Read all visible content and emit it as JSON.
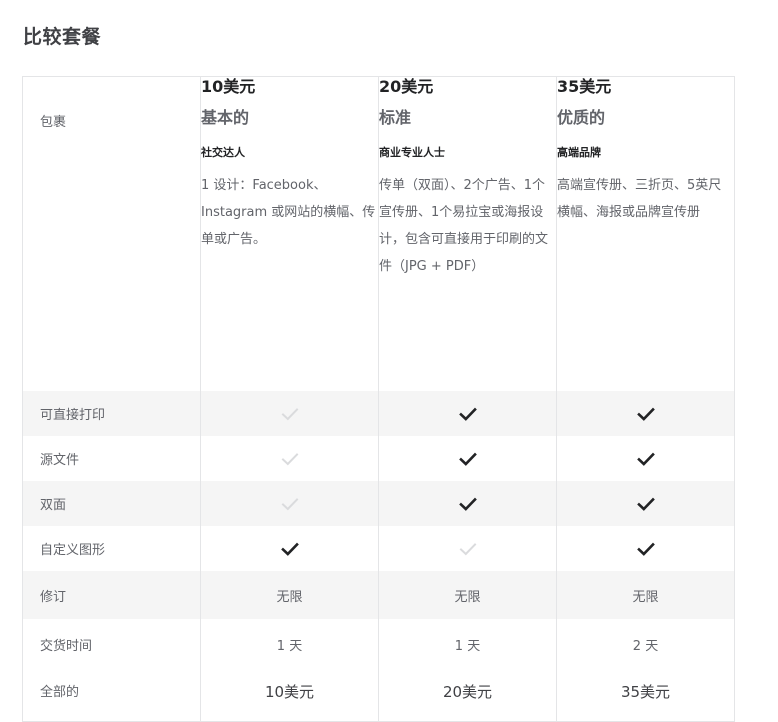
{
  "page": {
    "title": "比较套餐"
  },
  "table": {
    "header_label": "包裹",
    "packages": [
      {
        "price": "10美元",
        "name": "基本的",
        "tagline": "社交达人",
        "description": "1 设计：Facebook、Instagram 或网站的横幅、传单或广告。"
      },
      {
        "price": "20美元",
        "name": "标准",
        "tagline": "商业专业人士",
        "description": "传单（双面）、2个广告、1个宣传册、1个易拉宝或海报设计，包含可直接用于印刷的文件（JPG + PDF）"
      },
      {
        "price": "35美元",
        "name": "优质的",
        "tagline": "高端品牌",
        "description": "高端宣传册、三折页、5英尺横幅、海报或品牌宣传册"
      }
    ],
    "feature_rows": [
      {
        "label": "可直接打印",
        "values": [
          false,
          true,
          true
        ]
      },
      {
        "label": "源文件",
        "values": [
          false,
          true,
          true
        ]
      },
      {
        "label": "双面",
        "values": [
          false,
          true,
          true
        ]
      },
      {
        "label": "自定义图形",
        "values": [
          true,
          false,
          true
        ]
      }
    ],
    "text_rows": [
      {
        "label": "修订",
        "values": [
          "无限",
          "无限",
          "无限"
        ]
      },
      {
        "label": "交货时间",
        "values": [
          "1 天",
          "1 天",
          "2 天"
        ]
      }
    ],
    "total_row": {
      "label": "全部的",
      "values": [
        "10美元",
        "20美元",
        "35美元"
      ]
    }
  },
  "colors": {
    "check_active": "#222325",
    "check_inactive": "#dadbdd",
    "row_shade": "#f5f5f5",
    "border": "#e4e5e7"
  }
}
